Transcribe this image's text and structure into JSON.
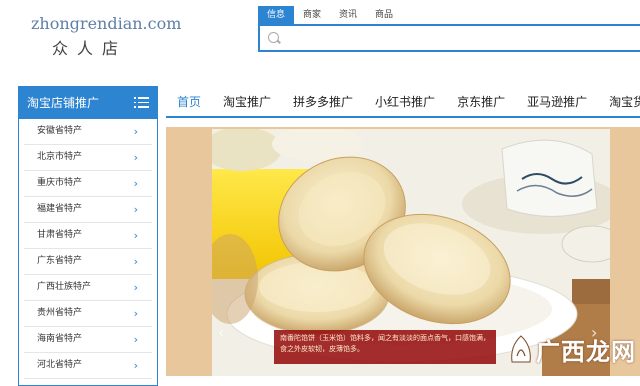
{
  "site": {
    "domain": "zhongrendian.com",
    "name_cn": "众人店"
  },
  "search": {
    "tabs": [
      "信息",
      "商家",
      "资讯",
      "商品"
    ],
    "active_tab": 0,
    "placeholder": ""
  },
  "sidebar": {
    "title": "淘宝店铺推广",
    "items": [
      {
        "label": "安徽省特产"
      },
      {
        "label": "北京市特产"
      },
      {
        "label": "重庆市特产"
      },
      {
        "label": "福建省特产"
      },
      {
        "label": "甘肃省特产"
      },
      {
        "label": "广东省特产"
      },
      {
        "label": "广西壮族特产"
      },
      {
        "label": "贵州省特产"
      },
      {
        "label": "海南省特产"
      },
      {
        "label": "河北省特产"
      }
    ]
  },
  "nav": {
    "items": [
      "首页",
      "淘宝推广",
      "拼多多推广",
      "小红书推广",
      "京东推广",
      "亚马逊推广",
      "淘宝货"
    ],
    "active": 0
  },
  "banner": {
    "caption": "南番陀馅饼（玉米馅）馅料多，闻之有淡淡的面点香气，口感饱满，食之外皮软韧，皮薄馅多。",
    "prev_arrow": "‹",
    "next_arrow": "›"
  },
  "watermark": {
    "text": "广西龙网"
  },
  "colors": {
    "accent": "#2d84d1",
    "banner_bg": "#e9c79c",
    "caption_bg": "#960f0f"
  }
}
